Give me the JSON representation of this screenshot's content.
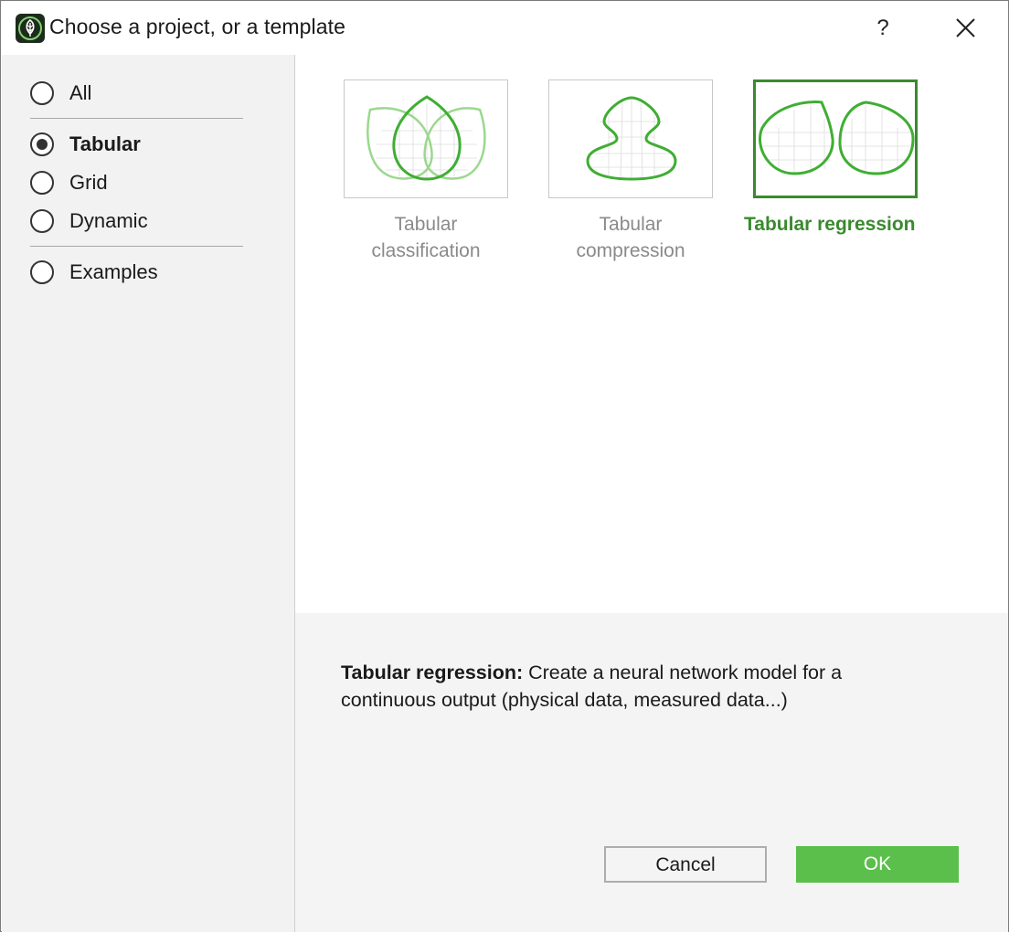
{
  "window": {
    "title": "Choose a project, or a template",
    "help_label": "?",
    "icons": {
      "app": "leaf-app-icon",
      "close": "close-icon"
    }
  },
  "sidebar": {
    "items": [
      {
        "label": "All",
        "checked": false
      },
      {
        "label": "Tabular",
        "checked": true
      },
      {
        "label": "Grid",
        "checked": false
      },
      {
        "label": "Dynamic",
        "checked": false
      },
      {
        "label": "Examples",
        "checked": false
      }
    ]
  },
  "templates": [
    {
      "line1": "Tabular",
      "line2": "classification",
      "selected": false,
      "icon": "classification-leaves-icon"
    },
    {
      "line1": "Tabular",
      "line2": "compression",
      "selected": false,
      "icon": "compression-vase-icon"
    },
    {
      "label": "Tabular regression",
      "selected": true,
      "icon": "regression-leaves-icon"
    }
  ],
  "description": {
    "title": "Tabular regression:",
    "text": " Create a neural network model for a continuous output (physical data, measured data...)"
  },
  "buttons": {
    "cancel": "Cancel",
    "ok": "OK"
  },
  "colors": {
    "accent": "#5bbf4c",
    "accent_dark": "#3a8a2e",
    "sidebar_bg": "#f2f2f2",
    "panel_bg": "#f4f4f4"
  }
}
